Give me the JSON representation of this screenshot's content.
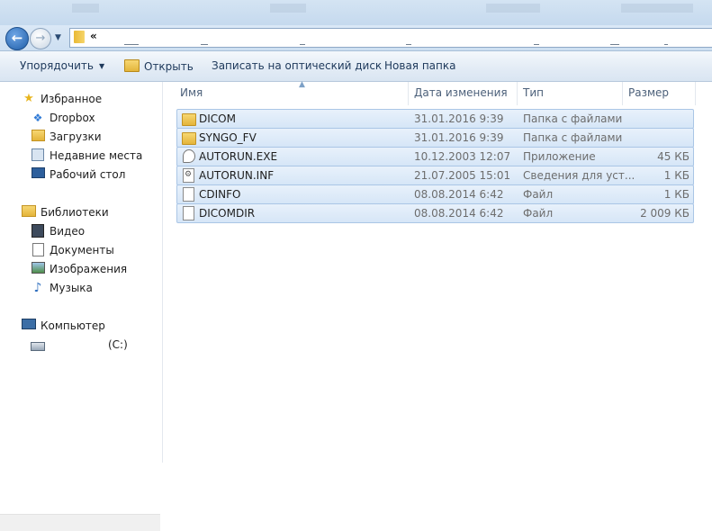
{
  "address": {
    "path_text": "«"
  },
  "toolbar": {
    "organize_label": "Упорядочить",
    "open_label": "Открыть",
    "burn_label": "Записать на оптический диск",
    "new_folder_label": "Новая папка"
  },
  "nav": {
    "favorites": {
      "label": "Избранное",
      "icon": "star-icon"
    },
    "favorites_items": [
      {
        "label": "Dropbox",
        "icon": "dropbox-icon"
      },
      {
        "label": "Загрузки",
        "icon": "downloads-folder-icon"
      },
      {
        "label": "Недавние места",
        "icon": "recent-places-icon"
      },
      {
        "label": "Рабочий стол",
        "icon": "desktop-icon"
      }
    ],
    "libraries": {
      "label": "Библиотеки",
      "icon": "libraries-icon"
    },
    "libraries_items": [
      {
        "label": "Видео",
        "icon": "video-icon"
      },
      {
        "label": "Документы",
        "icon": "documents-icon"
      },
      {
        "label": "Изображения",
        "icon": "pictures-icon"
      },
      {
        "label": "Музыка",
        "icon": "music-icon"
      }
    ],
    "computer": {
      "label": "Компьютер",
      "icon": "computer-icon"
    },
    "computer_items": [
      {
        "label": "(C:)",
        "icon": "drive-icon"
      }
    ]
  },
  "columns": {
    "name": "Имя",
    "date": "Дата изменения",
    "type": "Тип",
    "size": "Размер"
  },
  "files": [
    {
      "name": "DICOM",
      "date": "31.01.2016 9:39",
      "type": "Папка с файлами",
      "size": "",
      "icon": "folder-icon"
    },
    {
      "name": "SYNGO_FV",
      "date": "31.01.2016 9:39",
      "type": "Папка с файлами",
      "size": "",
      "icon": "folder-icon"
    },
    {
      "name": "AUTORUN.EXE",
      "date": "10.12.2003 12:07",
      "type": "Приложение",
      "size": "45 КБ",
      "icon": "exe-icon"
    },
    {
      "name": "AUTORUN.INF",
      "date": "21.07.2005 15:01",
      "type": "Сведения для уст...",
      "size": "1 КБ",
      "icon": "settings-file-icon"
    },
    {
      "name": "CDINFO",
      "date": "08.08.2014 6:42",
      "type": "Файл",
      "size": "1 КБ",
      "icon": "file-icon"
    },
    {
      "name": "DICOMDIR",
      "date": "08.08.2014 6:42",
      "type": "Файл",
      "size": "2 009 КБ",
      "icon": "file-icon"
    }
  ]
}
